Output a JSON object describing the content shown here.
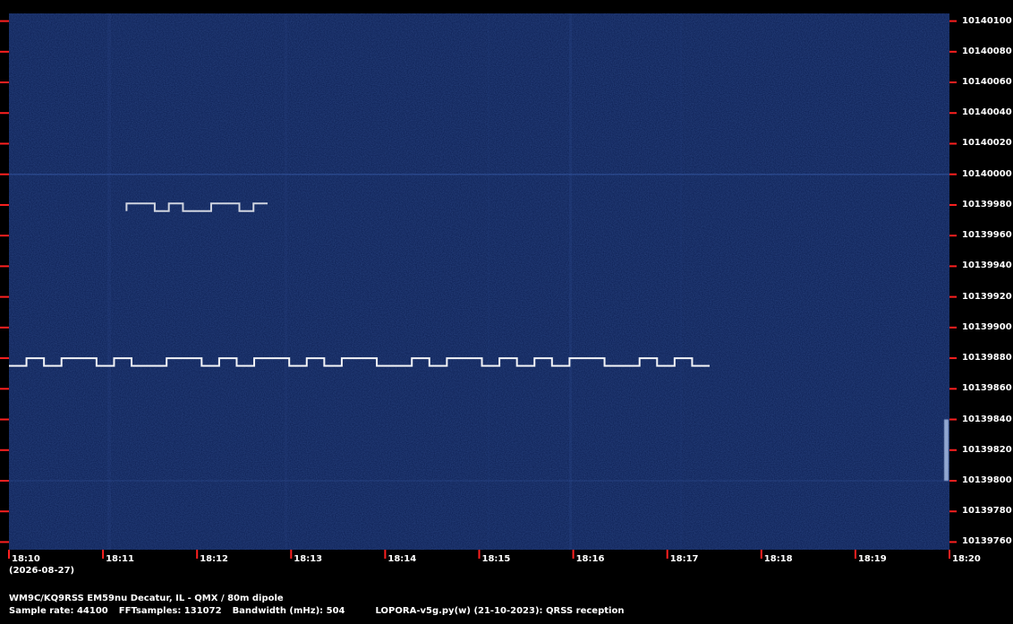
{
  "chart_data": {
    "type": "heatmap",
    "title": "",
    "x_ticks": [
      "18:10",
      "18:11",
      "18:12",
      "18:13",
      "18:14",
      "18:15",
      "18:16",
      "18:17",
      "18:18",
      "18:19",
      "18:20"
    ],
    "x_date": "(2026-08-27)",
    "y_ticks": [
      10140100,
      10140080,
      10140060,
      10140040,
      10140020,
      10140000,
      10139980,
      10139960,
      10139940,
      10139920,
      10139900,
      10139880,
      10139860,
      10139840,
      10139820,
      10139800,
      10139780,
      10139760
    ],
    "ylim": [
      10139755,
      10140105
    ],
    "xlim_minutes": [
      0,
      10
    ],
    "signals": [
      {
        "start": 0.0,
        "end": 7.45,
        "base_freq": 10139875,
        "high_freq": 10139880
      },
      {
        "start": 1.25,
        "end": 2.75,
        "base_freq": 10139976,
        "high_freq": 10139981
      },
      {
        "start": 10.0,
        "end": 10.0,
        "base_freq": 10139800,
        "high_freq": 10139840
      }
    ],
    "colors": {
      "background": "#0b1d50",
      "signal": "#ffffff",
      "tick": "#ff2020",
      "border": "#000000"
    }
  },
  "footer": {
    "station": "WM9C/KQ9RSS EM59nu Decatur, IL - QMX / 80m dipole",
    "sample_rate": "Sample rate: 44100",
    "fft": "FFTsamples: 131072",
    "bandwidth": "Bandwidth (mHz): 504",
    "software": "LOPORA-v5g.py(w) (21-10-2023): QRSS reception"
  }
}
